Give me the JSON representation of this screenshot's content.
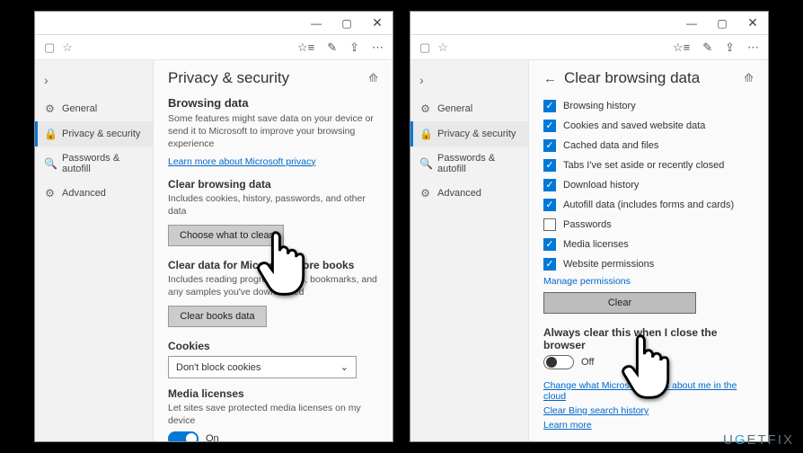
{
  "watermark": "UGETFIX",
  "sidebar": {
    "items": [
      {
        "icon": "⚙",
        "label": "General"
      },
      {
        "icon": "🔒",
        "label": "Privacy & security"
      },
      {
        "icon": "🔍",
        "label": "Passwords & autofill"
      },
      {
        "icon": "⚙",
        "label": "Advanced"
      }
    ]
  },
  "panelA": {
    "title": "Privacy & security",
    "section1_title": "Browsing data",
    "section1_sub": "Some features might save data on your device or send it to Microsoft to improve your browsing experience",
    "learn_link": "Learn more about Microsoft privacy",
    "clear_title": "Clear browsing data",
    "clear_sub": "Includes cookies, history, passwords, and other data",
    "clear_btn": "Choose what to clear",
    "books_title": "Clear data for Microsoft Store books",
    "books_sub": "Includes reading progress, notes, bookmarks, and any samples you've downloaded",
    "books_btn": "Clear books data",
    "cookies_title": "Cookies",
    "cookies_value": "Don't block cookies",
    "media_title": "Media licenses",
    "media_sub": "Let sites save protected media licenses on my device",
    "media_toggle": "On"
  },
  "panelB": {
    "title": "Clear browsing data",
    "items": [
      {
        "checked": true,
        "label": "Browsing history"
      },
      {
        "checked": true,
        "label": "Cookies and saved website data"
      },
      {
        "checked": true,
        "label": "Cached data and files"
      },
      {
        "checked": true,
        "label": "Tabs I've set aside or recently closed"
      },
      {
        "checked": true,
        "label": "Download history"
      },
      {
        "checked": true,
        "label": "Autofill data (includes forms and cards)"
      },
      {
        "checked": false,
        "label": "Passwords"
      },
      {
        "checked": true,
        "label": "Media licenses"
      },
      {
        "checked": true,
        "label": "Website permissions"
      }
    ],
    "manage_link": "Manage permissions",
    "clear_btn": "Clear",
    "always_title": "Always clear this when I close the browser",
    "always_toggle": "Off",
    "change_link": "Change what Microsoft knows about me in the cloud",
    "bing_link": "Clear Bing search history",
    "learn_link": "Learn more"
  }
}
